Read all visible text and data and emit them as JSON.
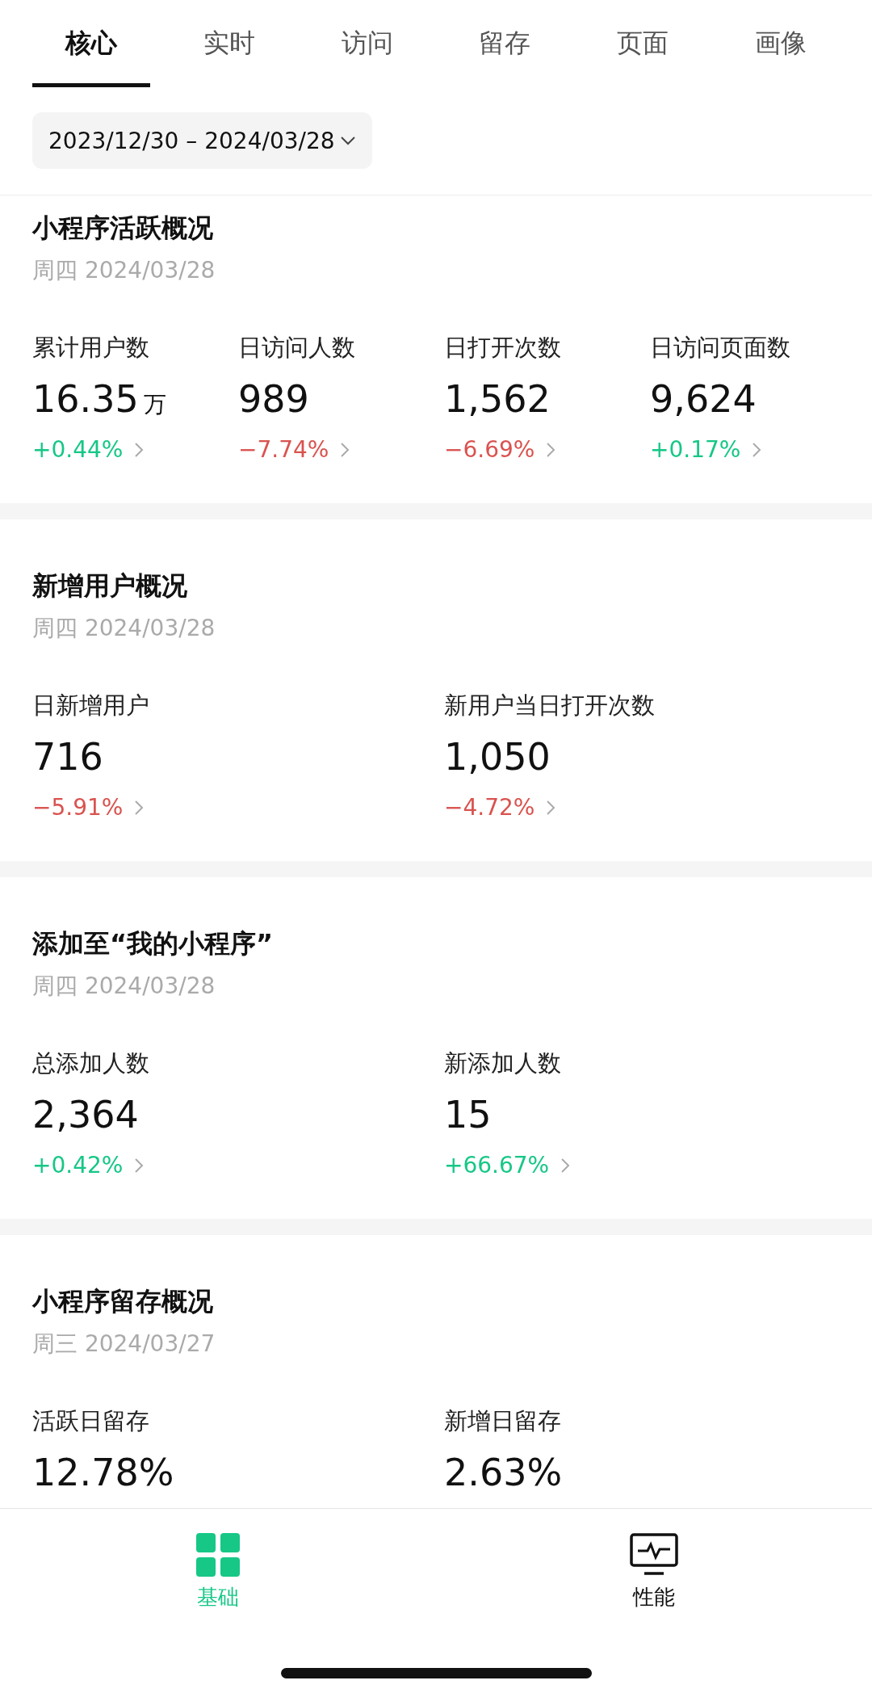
{
  "tabs": [
    {
      "label": "核心",
      "selected": true
    },
    {
      "label": "实时",
      "selected": false
    },
    {
      "label": "访问",
      "selected": false
    },
    {
      "label": "留存",
      "selected": false
    },
    {
      "label": "页面",
      "selected": false
    },
    {
      "label": "画像",
      "selected": false
    }
  ],
  "date_range": "2023/12/30 – 2024/03/28",
  "sections": [
    {
      "title": "小程序活跃概况",
      "date": "周四 2024/03/28",
      "metrics": [
        {
          "label": "累计用户数",
          "value": "16.35",
          "unit": "万",
          "change": "+0.44%",
          "color": "#16c786"
        },
        {
          "label": "日访问人数",
          "value": "989",
          "change": "−7.74%",
          "color": "#d9534f"
        },
        {
          "label": "日打开次数",
          "value": "1,562",
          "change": "−6.69%",
          "color": "#d9534f"
        },
        {
          "label": "日访问页面数",
          "value": "9,624",
          "change": "+0.17%",
          "color": "#16c786"
        }
      ]
    },
    {
      "title": "新增用户概况",
      "date": "周四 2024/03/28",
      "metrics": [
        {
          "label": "日新增用户",
          "value": "716",
          "change": "−5.91%",
          "color": "#d9534f"
        },
        {
          "label": "新用户当日打开次数",
          "value": "1,050",
          "change": "−4.72%",
          "color": "#d9534f"
        }
      ]
    },
    {
      "title": "添加至“我的小程序”",
      "date": "周四 2024/03/28",
      "metrics": [
        {
          "label": "总添加人数",
          "value": "2,364",
          "change": "+0.42%",
          "color": "#16c786"
        },
        {
          "label": "新添加人数",
          "value": "15",
          "change": "+66.67%",
          "color": "#16c786"
        }
      ]
    },
    {
      "title": "小程序留存概况",
      "date": "周三 2024/03/27",
      "metrics": [
        {
          "label": "活跃日留存",
          "value": "12.78%"
        },
        {
          "label": "新增日留存",
          "value": "2.63%"
        }
      ]
    }
  ],
  "bottom_nav": [
    {
      "label": "基础",
      "kind": "grid",
      "selected": true
    },
    {
      "label": "性能",
      "kind": "monitor",
      "selected": false
    }
  ]
}
